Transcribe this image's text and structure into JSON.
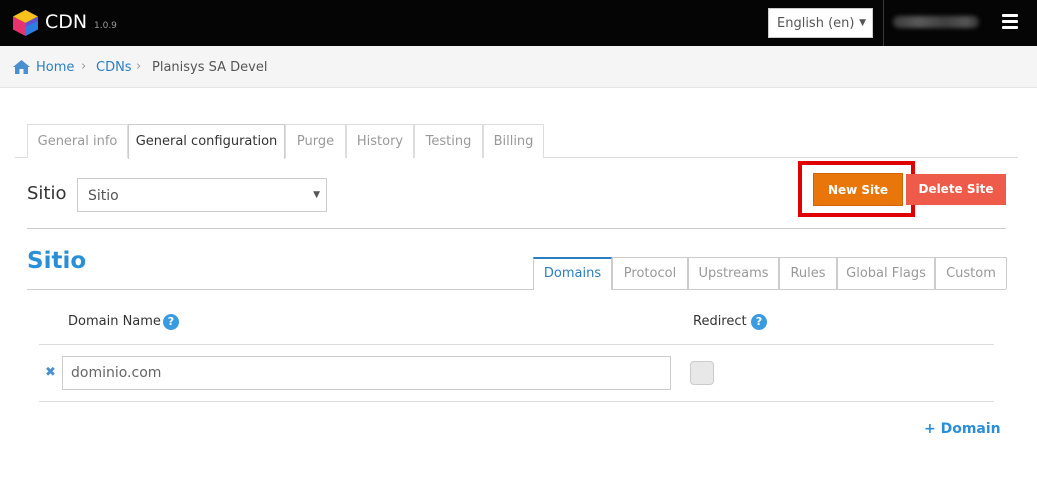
{
  "header": {
    "app_title": "CDN",
    "version": "1.0.9",
    "language": "English (en)"
  },
  "breadcrumb": {
    "items": [
      "Home",
      "CDNs",
      "Planisys SA Devel"
    ],
    "separator": "›"
  },
  "main_tabs": [
    {
      "label": "General info",
      "active": false
    },
    {
      "label": "General configuration",
      "active": true
    },
    {
      "label": "Purge",
      "active": false
    },
    {
      "label": "History",
      "active": false
    },
    {
      "label": "Testing",
      "active": false
    },
    {
      "label": "Billing",
      "active": false
    }
  ],
  "site_selector": {
    "label": "Sitio",
    "selected": "Sitio"
  },
  "buttons": {
    "new_site": "New Site",
    "delete_site": "Delete Site"
  },
  "section": {
    "title": "Sitio"
  },
  "sub_tabs": [
    {
      "label": "Domains",
      "active": true
    },
    {
      "label": "Protocol",
      "active": false
    },
    {
      "label": "Upstreams",
      "active": false
    },
    {
      "label": "Rules",
      "active": false
    },
    {
      "label": "Global Flags",
      "active": false
    },
    {
      "label": "Custom",
      "active": false
    }
  ],
  "domain_table": {
    "col_domain": "Domain Name",
    "col_redirect": "Redirect",
    "help_glyph": "?",
    "remove_glyph": "✖",
    "rows": [
      {
        "domain": "dominio.com",
        "redirect": false
      }
    ],
    "add_label": "+ Domain"
  },
  "colors": {
    "topbar": "#050505",
    "link": "#2b7fc1",
    "heading": "#2b8fd8",
    "new_site_button": "#e8760a",
    "delete_site_button": "#ef5b4a",
    "highlight": "#e00000"
  },
  "icons": {
    "logo": "cube-logo-icon",
    "home": "home-icon",
    "menu": "hamburger-menu-icon",
    "help": "help-circle-icon",
    "remove": "close-icon"
  }
}
